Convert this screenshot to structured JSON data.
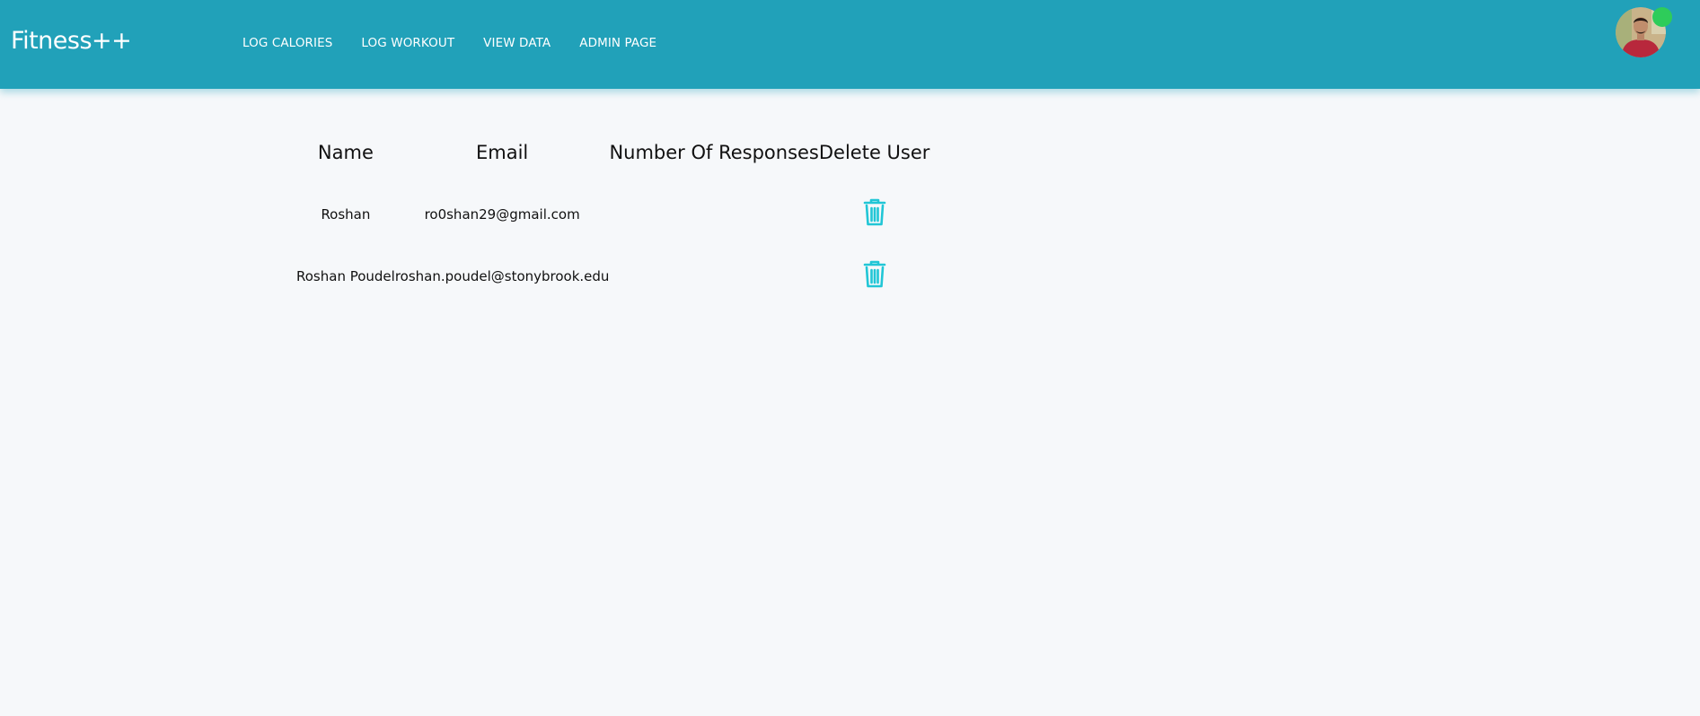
{
  "app": {
    "brand": "Fitness++"
  },
  "nav": {
    "items": [
      {
        "label": "LOG CALORIES"
      },
      {
        "label": "LOG WORKOUT"
      },
      {
        "label": "VIEW DATA"
      },
      {
        "label": "ADMIN PAGE"
      }
    ]
  },
  "user": {
    "avatar_icon": "user-avatar",
    "status": "online",
    "status_color": "#2ecc5a"
  },
  "table": {
    "headers": {
      "name": "Name",
      "email": "Email",
      "responses": "Number Of Responses",
      "delete": "Delete User"
    },
    "rows": [
      {
        "name": "Roshan",
        "email": "ro0shan29@gmail.com",
        "responses": "",
        "delete_icon": "trash-icon"
      },
      {
        "name": "Roshan Poudel",
        "email": "roshan.poudel@stonybrook.edu",
        "responses": "",
        "delete_icon": "trash-icon"
      }
    ]
  },
  "colors": {
    "navbar": "#21a1b9",
    "accent_icon": "#21c6d6",
    "background": "#f6f8fa"
  }
}
